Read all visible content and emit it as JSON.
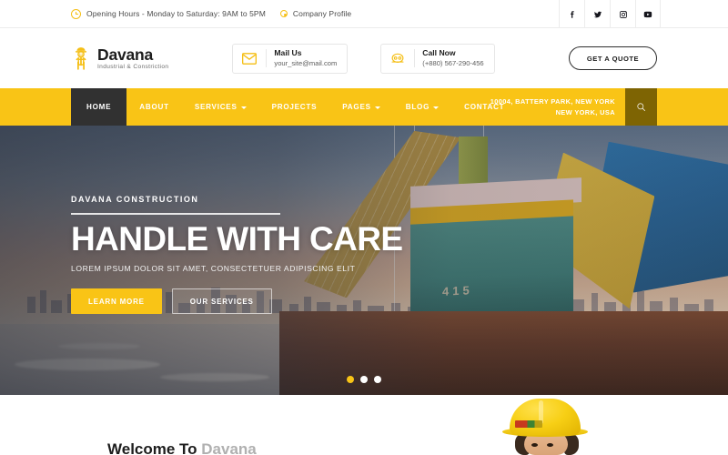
{
  "topbar": {
    "opening_hours": "Opening Hours - Monday to Saturday: 9AM to 5PM",
    "company_profile": "Company Profile",
    "socials": [
      {
        "name": "facebook",
        "label": "Facebook"
      },
      {
        "name": "twitter",
        "label": "Twitter"
      },
      {
        "name": "instagram",
        "label": "Instagram"
      },
      {
        "name": "youtube",
        "label": "YouTube"
      }
    ]
  },
  "header": {
    "brand": "Davana",
    "tagline": "Industrial & Constriction",
    "mail": {
      "title": "Mail Us",
      "value": "your_site@mail.com"
    },
    "call": {
      "title": "Call Now",
      "value": "(+880) 567-290-456"
    },
    "quote_label": "GET A QUOTE"
  },
  "nav": {
    "items": [
      {
        "label": "HOME",
        "active": true,
        "caret": false
      },
      {
        "label": "ABOUT",
        "active": false,
        "caret": false
      },
      {
        "label": "SERVICES",
        "active": false,
        "caret": true
      },
      {
        "label": "PROJECTS",
        "active": false,
        "caret": false
      },
      {
        "label": "PAGES",
        "active": false,
        "caret": true
      },
      {
        "label": "BLOG",
        "active": false,
        "caret": true
      },
      {
        "label": "CONTACT",
        "active": false,
        "caret": false
      }
    ],
    "address_line1": "10004, BATTERY PARK, NEW YORK",
    "address_line2": "NEW YORK, USA"
  },
  "hero": {
    "eyebrow": "DAVANA CONSTRUCTION",
    "title": "HANDLE WITH CARE",
    "subtitle": "LOREM IPSUM DOLOR SIT AMET, CONSECTETUER ADIPISCING ELIT",
    "primary_btn": "LEARN MORE",
    "secondary_btn": "OUR SERVICES",
    "crane_number": "415",
    "slides": [
      {
        "active": true
      },
      {
        "active": false
      },
      {
        "active": false
      }
    ]
  },
  "welcome": {
    "prefix": "Welcome To ",
    "brand": "Davana"
  },
  "colors": {
    "accent": "#f9c416",
    "accent_dark": "#7e6403",
    "nav_active": "#313131",
    "text_dark": "#1d1d1d",
    "text_muted": "#b0b0b0"
  }
}
